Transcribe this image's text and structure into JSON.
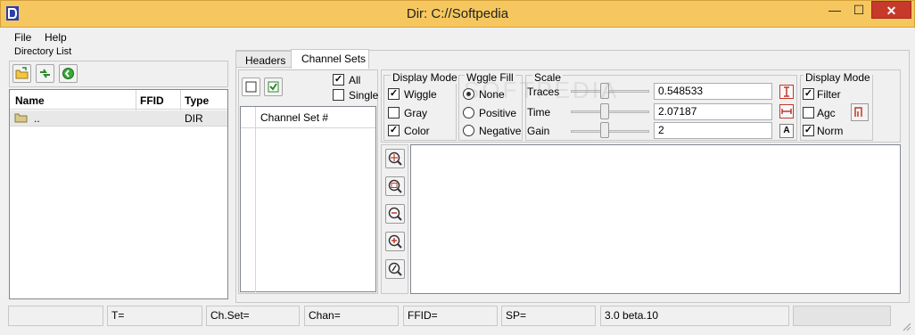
{
  "window": {
    "title": "Dir: C://Softpedia",
    "minimize": "—",
    "maximize": "☐",
    "close": "✕"
  },
  "menu": {
    "items": [
      "File",
      "Help"
    ]
  },
  "directory": {
    "group_label": "Directory List",
    "columns": [
      "Name",
      "FFID",
      "Type"
    ],
    "rows": [
      {
        "name": "..",
        "ffid": "",
        "type": "DIR"
      }
    ]
  },
  "tabs": [
    "Headers",
    "Channel Sets"
  ],
  "channel": {
    "all_label": "All",
    "single_label": "Single",
    "all_checked": true,
    "single_checked": false,
    "column_header": "Channel Set #"
  },
  "display_mode_left": {
    "label": "Display Mode",
    "options": [
      {
        "label": "Wiggle",
        "checked": true
      },
      {
        "label": "Gray",
        "checked": false
      },
      {
        "label": "Color",
        "checked": true
      }
    ]
  },
  "wiggle_fill": {
    "label": "Wggle Fill",
    "options": [
      {
        "label": "None",
        "selected": true
      },
      {
        "label": "Positive",
        "selected": false
      },
      {
        "label": "Negative",
        "selected": false
      }
    ]
  },
  "scale": {
    "label": "Scale",
    "traces_label": "Traces",
    "traces_value": "0.548533",
    "time_label": "Time",
    "time_value": "2.07187",
    "gain_label": "Gain",
    "gain_value": "2",
    "gain_button": "A"
  },
  "display_mode_right": {
    "label": "Display Mode",
    "filter_label": "Filter",
    "filter_checked": true,
    "agc_label": "Agc",
    "agc_checked": false,
    "norm_label": "Norm",
    "norm_checked": true
  },
  "watermark": "SOFTPEDIA",
  "status": [
    "",
    "T=",
    "Ch.Set=",
    "Chan=",
    "FFID=",
    "SP=",
    "3.0 beta.10",
    ""
  ],
  "colors": {
    "titlebar": "#f6c75e",
    "close": "#c7392b",
    "window_bg": "#f0f0f0"
  }
}
